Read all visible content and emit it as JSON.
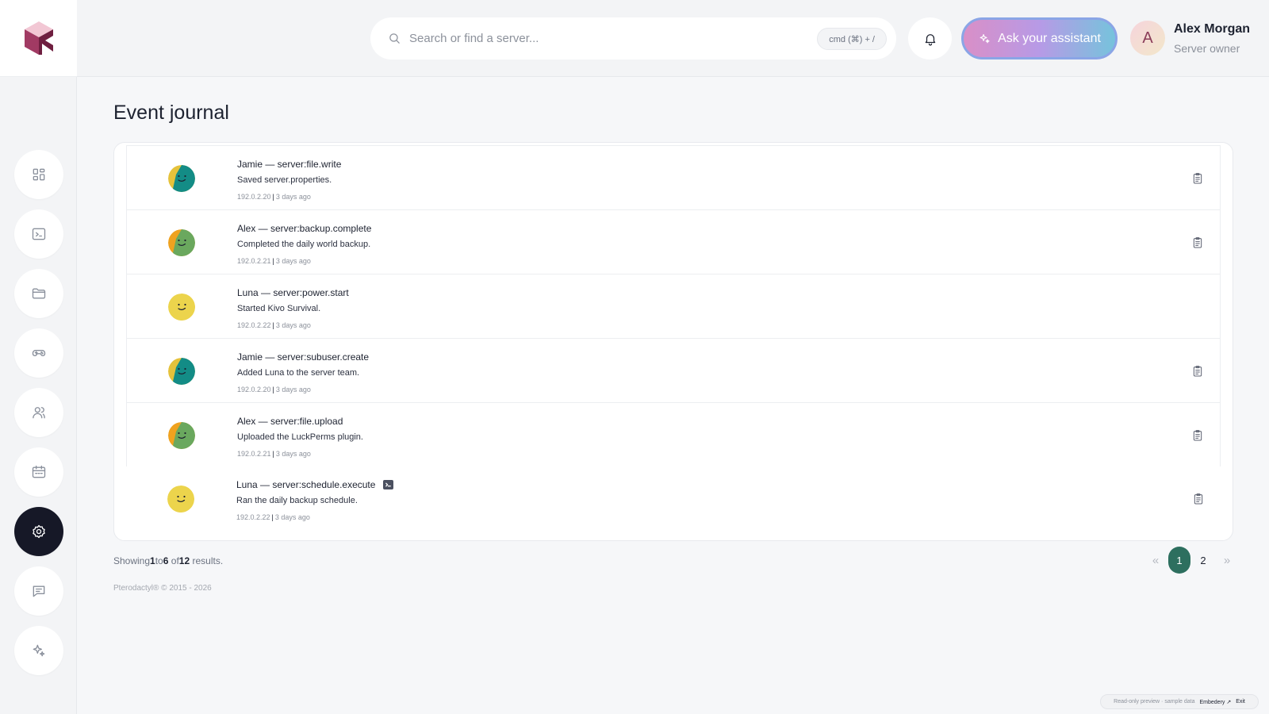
{
  "topbar": {
    "search_placeholder": "Search or find a server...",
    "search_shortcut": "cmd (⌘) + /",
    "assistant_label": "Ask your assistant",
    "user": {
      "initial": "A",
      "name": "Alex Morgan",
      "role": "Server owner"
    }
  },
  "sidebar": {
    "items": [
      {
        "icon": "dashboard-icon"
      },
      {
        "icon": "console-icon"
      },
      {
        "icon": "folder-icon"
      },
      {
        "icon": "gamepad-icon"
      },
      {
        "icon": "users-icon"
      },
      {
        "icon": "calendar-icon"
      },
      {
        "icon": "settings-icon",
        "active": true
      },
      {
        "icon": "chat-icon"
      },
      {
        "icon": "sparkles-icon"
      }
    ]
  },
  "page": {
    "title": "Event journal"
  },
  "events": [
    {
      "user": "Jamie",
      "event": "server:file.write",
      "title": "Jamie — server:file.write",
      "description": "Saved server.properties.",
      "ip": "192.0.2.20",
      "time": "3 days ago",
      "avatar_color": "#138c86",
      "accent": "#e5c23b",
      "has_clip": true,
      "has_terminal": false
    },
    {
      "user": "Alex",
      "event": "server:backup.complete",
      "title": "Alex — server:backup.complete",
      "description": "Completed the daily world backup.",
      "ip": "192.0.2.21",
      "time": "3 days ago",
      "avatar_color": "#6aa85e",
      "accent": "#efa21f",
      "has_clip": true,
      "has_terminal": false
    },
    {
      "user": "Luna",
      "event": "server:power.start",
      "title": "Luna — server:power.start",
      "description": "Started Kivo Survival.",
      "ip": "192.0.2.22",
      "time": "3 days ago",
      "avatar_color": "#ecd44c",
      "accent": "#ecd44c",
      "has_clip": false,
      "has_terminal": false
    },
    {
      "user": "Jamie",
      "event": "server:subuser.create",
      "title": "Jamie — server:subuser.create",
      "description": "Added Luna to the server team.",
      "ip": "192.0.2.20",
      "time": "3 days ago",
      "avatar_color": "#138c86",
      "accent": "#e5c23b",
      "has_clip": true,
      "has_terminal": false
    },
    {
      "user": "Alex",
      "event": "server:file.upload",
      "title": "Alex — server:file.upload",
      "description": "Uploaded the LuckPerms plugin.",
      "ip": "192.0.2.21",
      "time": "3 days ago",
      "avatar_color": "#6aa85e",
      "accent": "#efa21f",
      "has_clip": true,
      "has_terminal": false
    },
    {
      "user": "Luna",
      "event": "server:schedule.execute",
      "title": "Luna — server:schedule.execute",
      "description": "Ran the daily backup schedule.",
      "ip": "192.0.2.22",
      "time": "3 days ago",
      "avatar_color": "#ecd44c",
      "accent": "#ecd44c",
      "has_clip": true,
      "has_terminal": true
    }
  ],
  "pagination": {
    "showing_prefix": "Showing",
    "from": "1",
    "to_word": "to",
    "to": "6",
    "of_word": "of",
    "total": "12",
    "results_word": "results.",
    "prev": "«",
    "pages": [
      "1",
      "2"
    ],
    "current": "1",
    "next": "»"
  },
  "footer": {
    "copyright": "Pterodactyl® © 2015 - 2026"
  },
  "preview_bar": {
    "text": "Read-only preview · sample data",
    "link": "Embedery ↗",
    "exit": "Exit"
  },
  "colors": {
    "active_nav": "#161827",
    "pager_active": "#2d6f5f",
    "logo_primary": "#8a2a4f"
  }
}
